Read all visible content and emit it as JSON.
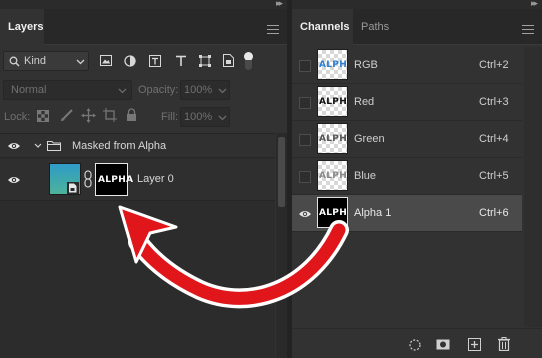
{
  "layers_panel": {
    "tab_label": "Layers",
    "filter": {
      "kind_label": "Kind"
    },
    "blend_mode": "Normal",
    "opacity_label": "Opacity:",
    "opacity_value": "100%",
    "lock_label": "Lock:",
    "fill_label": "Fill:",
    "fill_value": "100%",
    "group": {
      "name": "Masked from Alpha"
    },
    "layer": {
      "name": "Layer 0",
      "mask_text": "ALPHA"
    }
  },
  "channels_panel": {
    "tabs": [
      {
        "label": "Channels",
        "active": true
      },
      {
        "label": "Paths",
        "active": false
      }
    ],
    "channels": [
      {
        "name": "RGB",
        "shortcut": "Ctrl+2",
        "thumb_text": "ALPHA",
        "text_color": "#2a7fd4",
        "visible": false
      },
      {
        "name": "Red",
        "shortcut": "Ctrl+3",
        "thumb_text": "ALPHA",
        "text_color": "#111111",
        "visible": false
      },
      {
        "name": "Green",
        "shortcut": "Ctrl+4",
        "thumb_text": "ALPHA",
        "text_color": "#555555",
        "visible": false
      },
      {
        "name": "Blue",
        "shortcut": "Ctrl+5",
        "thumb_text": "ALPHA",
        "text_color": "#888888",
        "visible": false
      },
      {
        "name": "Alpha 1",
        "shortcut": "Ctrl+6",
        "thumb_text": "ALPHA",
        "text_color": "#ffffff",
        "visible": true,
        "selected": true
      }
    ]
  },
  "annotation": {
    "arrow_color": "#e0161b"
  },
  "colors": {
    "panel_bg": "#323232",
    "selected_row": "#4a4a4a",
    "accent_red": "#e0161b"
  }
}
